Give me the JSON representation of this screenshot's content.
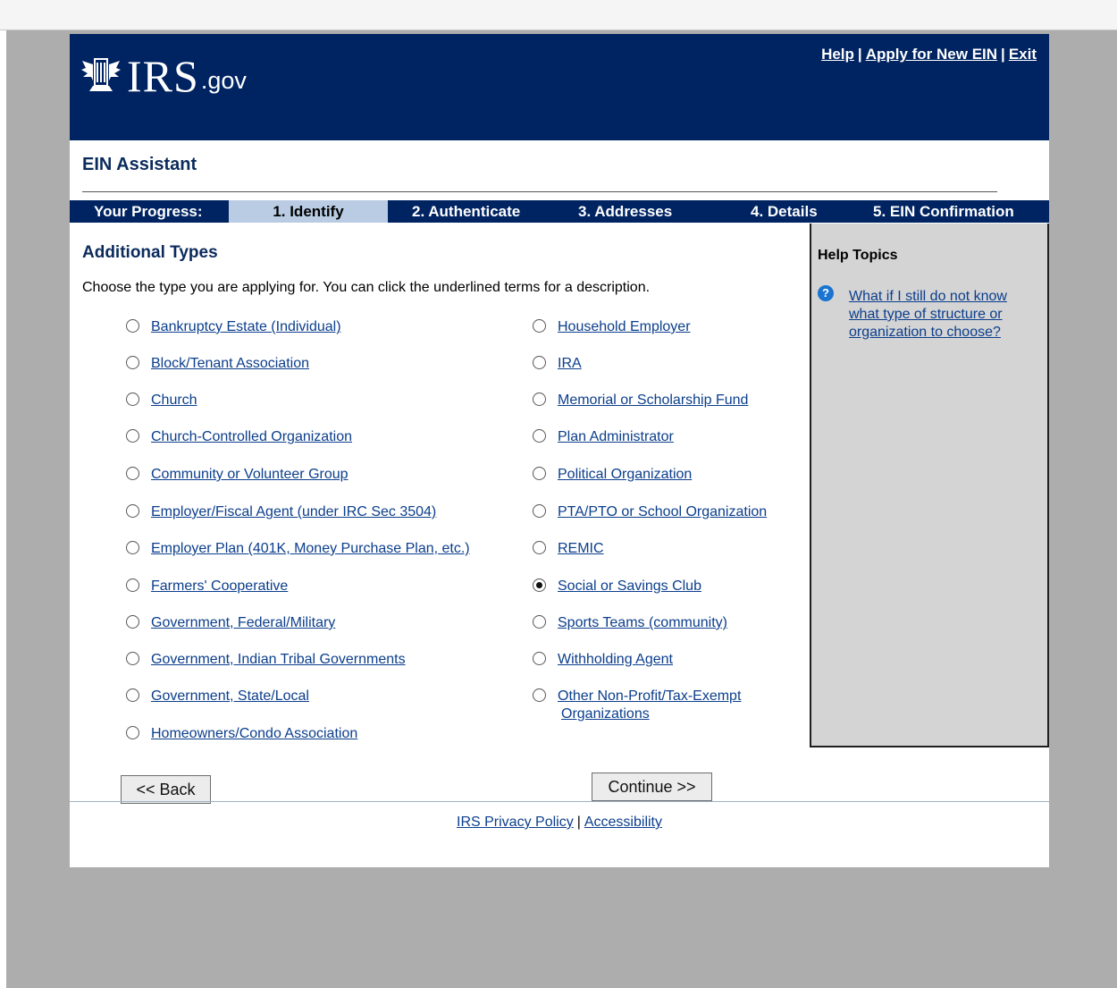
{
  "header": {
    "logo_text": "IRS",
    "logo_suffix": ".gov",
    "links": {
      "help": "Help",
      "apply": "Apply for New EIN",
      "exit": "Exit",
      "separator": "|"
    }
  },
  "app_title": "EIN Assistant",
  "progress": {
    "label": "Your Progress:",
    "steps": [
      "1. Identify",
      "2. Authenticate",
      "3. Addresses",
      "4. Details",
      "5. EIN Confirmation"
    ],
    "active_step": "1. Identify"
  },
  "main": {
    "title": "Additional Types",
    "intro": "Choose the type you are applying for. You can click the underlined terms for a description.",
    "left_options": [
      "Bankruptcy Estate (Individual)",
      "Block/Tenant Association",
      "Church",
      "Church-Controlled Organization",
      "Community or Volunteer Group",
      "Employer/Fiscal Agent (under IRC Sec 3504)",
      "Employer Plan (401K, Money Purchase Plan, etc.)",
      "Farmers' Cooperative",
      "Government, Federal/Military",
      "Government, Indian Tribal Governments",
      "Government, State/Local",
      "Homeowners/Condo Association"
    ],
    "right_options": [
      "Household Employer",
      "IRA",
      "Memorial or Scholarship Fund",
      "Plan Administrator",
      "Political Organization",
      "PTA/PTO or School Organization",
      "REMIC",
      "Social or Savings Club",
      "Sports Teams (community)",
      "Withholding Agent",
      "Other Non-Profit/Tax-Exempt"
    ],
    "right_option_last_line2": "Organizations",
    "selected": "Social or Savings Club"
  },
  "help": {
    "title": "Help Topics",
    "icon": "question-circle-icon",
    "link": "What if I still do not know what type of structure or organization to choose?"
  },
  "buttons": {
    "back": "<< Back",
    "continue": "Continue >>"
  },
  "footer": {
    "privacy": "IRS Privacy Policy",
    "separator": "|",
    "accessibility": "Accessibility"
  },
  "colors": {
    "navy": "#002462",
    "active_step": "#b9cce4",
    "link": "#0b3e8c",
    "help_bg": "#d4d4d4",
    "outer_bg": "#adadad"
  }
}
